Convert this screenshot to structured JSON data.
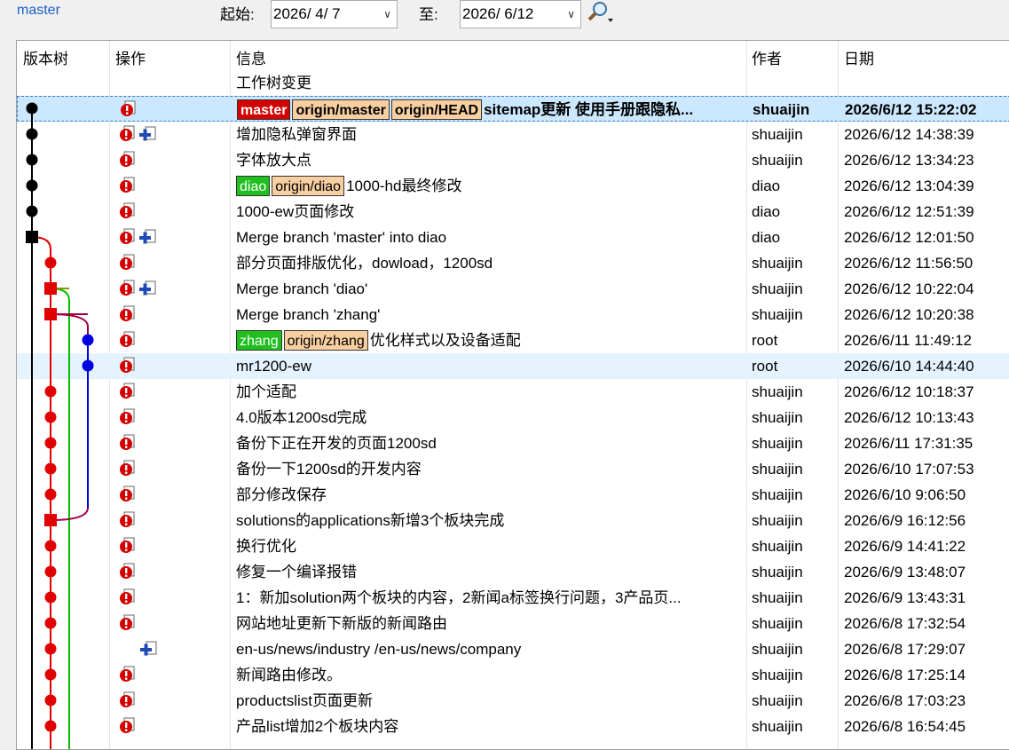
{
  "toolbar": {
    "branch": "master",
    "from_label": "起始:",
    "from_date": "2026/  4/  7",
    "to_label": "至:",
    "to_date": "2026/  6/12"
  },
  "columns": {
    "graph": "版本树",
    "actions": "操作",
    "message": "信息",
    "author": "作者",
    "date": "日期"
  },
  "working_tree_label": "工作树变更",
  "commits": [
    {
      "refs": [
        {
          "name": "master",
          "kind": "head-local"
        },
        {
          "name": "origin/master",
          "kind": "remote"
        },
        {
          "name": "origin/HEAD",
          "kind": "remote"
        }
      ],
      "message": "sitemap更新 使用手册跟隐私...",
      "author": "shuaijin",
      "date": "2026/6/12 15:22:02",
      "bold": true,
      "selected": true,
      "ops": [
        "mod"
      ]
    },
    {
      "refs": [],
      "message": "增加隐私弹窗界面",
      "author": "shuaijin",
      "date": "2026/6/12 14:38:39",
      "ops": [
        "mod",
        "add"
      ]
    },
    {
      "refs": [],
      "message": "字体放大点",
      "author": "shuaijin",
      "date": "2026/6/12 13:34:23",
      "ops": [
        "mod"
      ]
    },
    {
      "refs": [
        {
          "name": "diao",
          "kind": "local"
        },
        {
          "name": "origin/diao",
          "kind": "remote"
        }
      ],
      "message": "1000-hd最终修改",
      "author": "diao",
      "date": "2026/6/12 13:04:39",
      "ops": [
        "mod"
      ]
    },
    {
      "refs": [],
      "message": "1000-ew页面修改",
      "author": "diao",
      "date": "2026/6/12 12:51:39",
      "ops": [
        "mod"
      ]
    },
    {
      "refs": [],
      "message": "Merge branch 'master' into diao",
      "author": "diao",
      "date": "2026/6/12 12:01:50",
      "ops": [
        "mod",
        "add"
      ]
    },
    {
      "refs": [],
      "message": "部分页面排版优化，dowload，1200sd",
      "author": "shuaijin",
      "date": "2026/6/12 11:56:50",
      "ops": [
        "mod"
      ]
    },
    {
      "refs": [],
      "message": "Merge branch 'diao'",
      "author": "shuaijin",
      "date": "2026/6/12 10:22:04",
      "ops": [
        "mod",
        "add"
      ]
    },
    {
      "refs": [],
      "message": "Merge branch 'zhang'",
      "author": "shuaijin",
      "date": "2026/6/12 10:20:38",
      "ops": [
        "mod"
      ]
    },
    {
      "refs": [
        {
          "name": "zhang",
          "kind": "local"
        },
        {
          "name": "origin/zhang",
          "kind": "remote"
        }
      ],
      "message": "优化样式以及设备适配",
      "author": "root",
      "date": "2026/6/11 11:49:12",
      "ops": [
        "mod"
      ]
    },
    {
      "refs": [],
      "message": "mr1200-ew",
      "author": "root",
      "date": "2026/6/10 14:44:40",
      "hover": true,
      "ops": [
        "mod"
      ]
    },
    {
      "refs": [],
      "message": "加个适配",
      "author": "shuaijin",
      "date": "2026/6/12 10:18:37",
      "ops": [
        "mod"
      ]
    },
    {
      "refs": [],
      "message": "4.0版本1200sd完成",
      "author": "shuaijin",
      "date": "2026/6/12 10:13:43",
      "ops": [
        "mod"
      ]
    },
    {
      "refs": [],
      "message": "备份下正在开发的页面1200sd",
      "author": "shuaijin",
      "date": "2026/6/11 17:31:35",
      "ops": [
        "mod"
      ]
    },
    {
      "refs": [],
      "message": "备份一下1200sd的开发内容",
      "author": "shuaijin",
      "date": "2026/6/10 17:07:53",
      "ops": [
        "mod"
      ]
    },
    {
      "refs": [],
      "message": "部分修改保存",
      "author": "shuaijin",
      "date": "2026/6/10 9:06:50",
      "ops": [
        "mod"
      ]
    },
    {
      "refs": [],
      "message": "solutions的applications新增3个板块完成",
      "author": "shuaijin",
      "date": "2026/6/9 16:12:56",
      "ops": [
        "mod"
      ]
    },
    {
      "refs": [],
      "message": "换行优化",
      "author": "shuaijin",
      "date": "2026/6/9 14:41:22",
      "ops": [
        "mod"
      ]
    },
    {
      "refs": [],
      "message": "修复一个编译报错",
      "author": "shuaijin",
      "date": "2026/6/9 13:48:07",
      "ops": [
        "mod"
      ]
    },
    {
      "refs": [],
      "message": "1：新加solution两个板块的内容，2新闻a标签换行问题，3产品页...",
      "author": "shuaijin",
      "date": "2026/6/9 13:43:31",
      "ops": [
        "mod"
      ]
    },
    {
      "refs": [],
      "message": "网站地址更新下新版的新闻路由",
      "author": "shuaijin",
      "date": "2026/6/8 17:32:54",
      "ops": [
        "mod"
      ]
    },
    {
      "refs": [],
      "message": "en-us/news/industry  /en-us/news/company",
      "author": "shuaijin",
      "date": "2026/6/8 17:29:07",
      "ops": [
        "add"
      ]
    },
    {
      "refs": [],
      "message": "新闻路由修改。",
      "author": "shuaijin",
      "date": "2026/6/8 17:25:14",
      "ops": [
        "mod"
      ]
    },
    {
      "refs": [],
      "message": "productslist页面更新",
      "author": "shuaijin",
      "date": "2026/6/8 17:03:23",
      "ops": [
        "mod"
      ]
    },
    {
      "refs": [],
      "message": "产品list增加2个板块内容",
      "author": "shuaijin",
      "date": "2026/6/8 16:54:45",
      "ops": [
        "mod"
      ]
    }
  ],
  "colors": {
    "lane_master": "#000000",
    "lane_diao": "#e00000",
    "lane_zhang": "#00c000",
    "lane_blue": "#0000e0",
    "lane_merge": "#a00040",
    "lane_olive": "#909000",
    "selection": "#cce8ff"
  },
  "icons": {
    "modified": "modified-file-icon",
    "added": "added-file-icon",
    "search": "search-magnifier-icon"
  }
}
